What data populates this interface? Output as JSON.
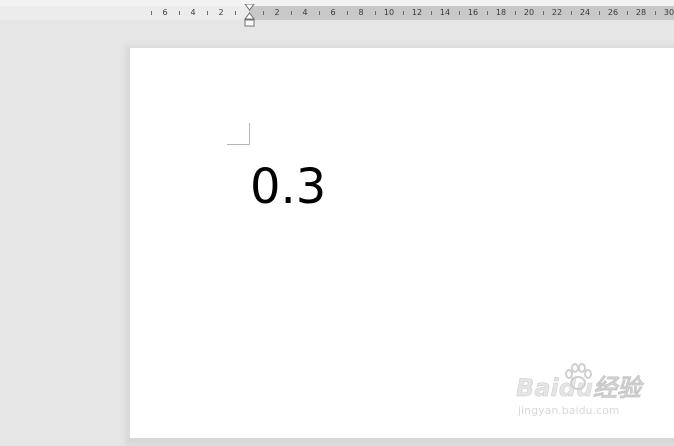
{
  "ruler": {
    "left_ticks": [
      "6",
      "4",
      "2"
    ],
    "right_ticks": [
      "2",
      "4",
      "6",
      "8",
      "10",
      "12",
      "14",
      "16",
      "18",
      "20",
      "22",
      "24",
      "26",
      "28",
      "30"
    ]
  },
  "document": {
    "text": "0.3"
  },
  "watermark": {
    "main": "Baidu经验",
    "sub": "jingyan.baidu.com"
  }
}
